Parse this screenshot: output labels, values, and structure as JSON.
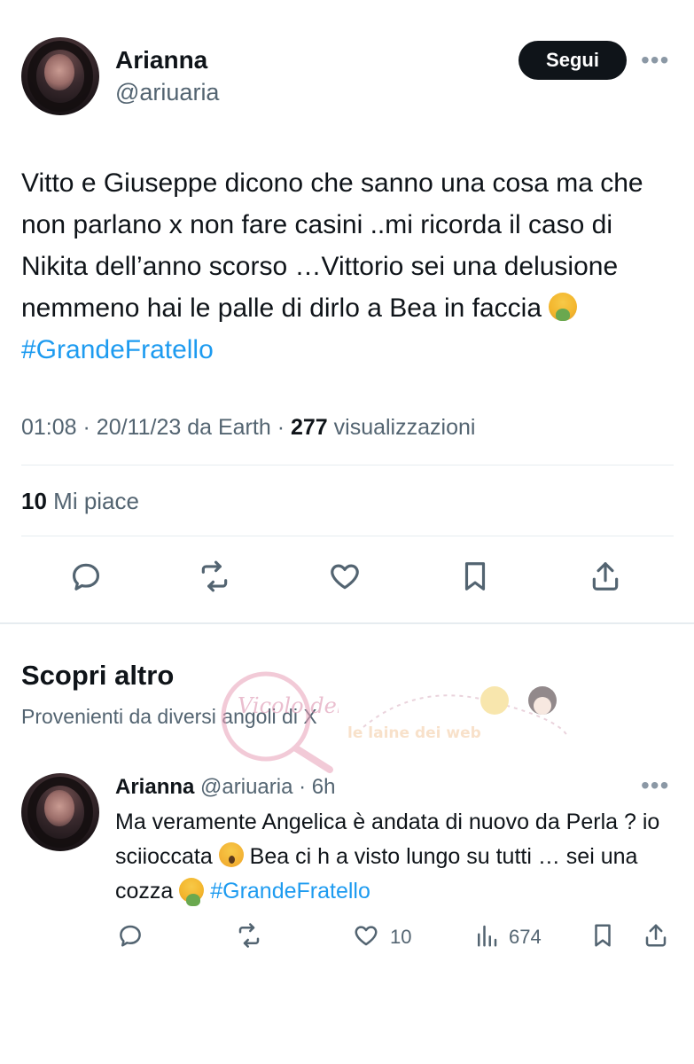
{
  "tweet": {
    "author_name": "Arianna",
    "author_handle": "@ariuaria",
    "follow_label": "Segui",
    "more_label": "•••",
    "text_main": "Vitto e Giuseppe dicono che sanno una cosa ma che non parlano x non fare casini ..mi ricorda il caso di Nikita dell’anno scorso …Vittorio sei una delusione nemmeno hai le palle di dirlo a Bea in faccia",
    "hashtag": "#GrandeFratello",
    "time": "01:08",
    "date": "20/11/23",
    "source": "da Earth",
    "views_count": "277",
    "views_label": "visualizzazioni",
    "likes_count": "10",
    "likes_label": "Mi piace"
  },
  "actions": {
    "icons": [
      "reply-icon",
      "retweet-icon",
      "like-icon",
      "bookmark-icon",
      "share-icon"
    ]
  },
  "discover": {
    "title": "Scopri altro",
    "subtitle": "Provenienti da diversi angoli di X"
  },
  "reply": {
    "author_name": "Arianna",
    "author_handle": "@ariuaria",
    "time_ago": "6h",
    "more_label": "•••",
    "text_part1": "Ma veramente Angelica è andata di nuovo da Perla ? io sciocata",
    "text_part1_exact": "Ma veramente Angelica è andata di nuovo da Perla ? io sciioccata",
    "text_a": "Ma veramente Angelica è andata di nuovo da Perla ? io sciioccata",
    "text_b": "Bea ci h a visto lungo su tutti … sei una cozza",
    "hashtag": "#GrandeFratello",
    "likes_count": "10",
    "views_count": "674"
  },
  "watermarks": {
    "left": "Vicolo delle News",
    "right": "le laine dei web"
  },
  "colors": {
    "accent": "#1d9bf0",
    "text_primary": "#0f1419",
    "text_secondary": "#536471",
    "button_dark": "#0f1419"
  }
}
